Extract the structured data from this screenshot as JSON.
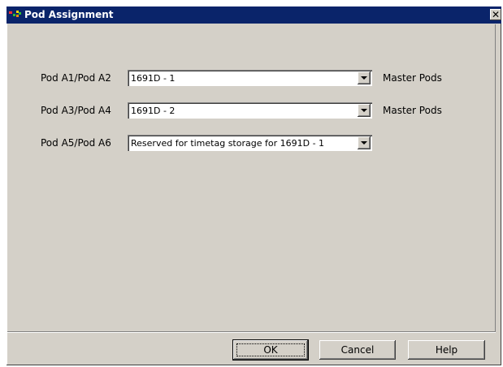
{
  "window": {
    "title": "Pod Assignment",
    "title_icon": "pods-app-icon",
    "close_label": "✕"
  },
  "rows": [
    {
      "label": "Pod A1/Pod A2",
      "value": "1691D - 1",
      "side_label": "Master Pods"
    },
    {
      "label": "Pod A3/Pod A4",
      "value": "1691D - 2",
      "side_label": "Master Pods"
    },
    {
      "label": "Pod A5/Pod A6",
      "value": "Reserved for timetag storage for 1691D - 1",
      "side_label": ""
    }
  ],
  "buttons": {
    "ok": "OK",
    "cancel": "Cancel",
    "help": "Help"
  },
  "colors": {
    "titlebar": "#0a246a",
    "face": "#d4d0c8"
  }
}
